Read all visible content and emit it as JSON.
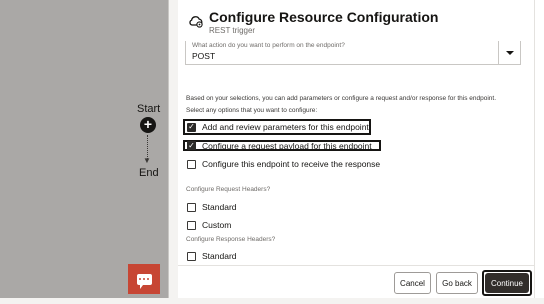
{
  "canvas": {
    "start_label": "Start",
    "end_label": "End",
    "start_node_glyph": "+",
    "chat_icon": "chat-bubble-icon"
  },
  "panel": {
    "title": "Configure Resource Configuration",
    "subtitle": "REST trigger",
    "header_icon": "cloud-gear-icon",
    "action_select": {
      "label": "What action do you want to perform on the endpoint?",
      "value": "POST"
    },
    "info_text": "Based on your selections, you can add parameters or configure a request and/or response for this endpoint.",
    "options_prompt": "Select any options that you want to configure:",
    "options": [
      {
        "label": "Add and review parameters for this endpoint",
        "checked": true
      },
      {
        "label": "Configure a request payload for this endpoint",
        "checked": true
      },
      {
        "label": "Configure this endpoint to receive the response",
        "checked": false
      }
    ],
    "request_headers": {
      "heading": "Configure Request Headers?",
      "options": [
        {
          "label": "Standard",
          "checked": false
        },
        {
          "label": "Custom",
          "checked": false
        }
      ]
    },
    "response_headers": {
      "heading": "Configure Response Headers?",
      "options": [
        {
          "label": "Standard",
          "checked": false
        }
      ]
    }
  },
  "footer": {
    "cancel_label": "Cancel",
    "back_label": "Go back",
    "continue_label": "Continue"
  },
  "colors": {
    "canvas_bg": "#aaa8a6",
    "chat_button": "#c74634",
    "primary_button": "#312d2a"
  }
}
